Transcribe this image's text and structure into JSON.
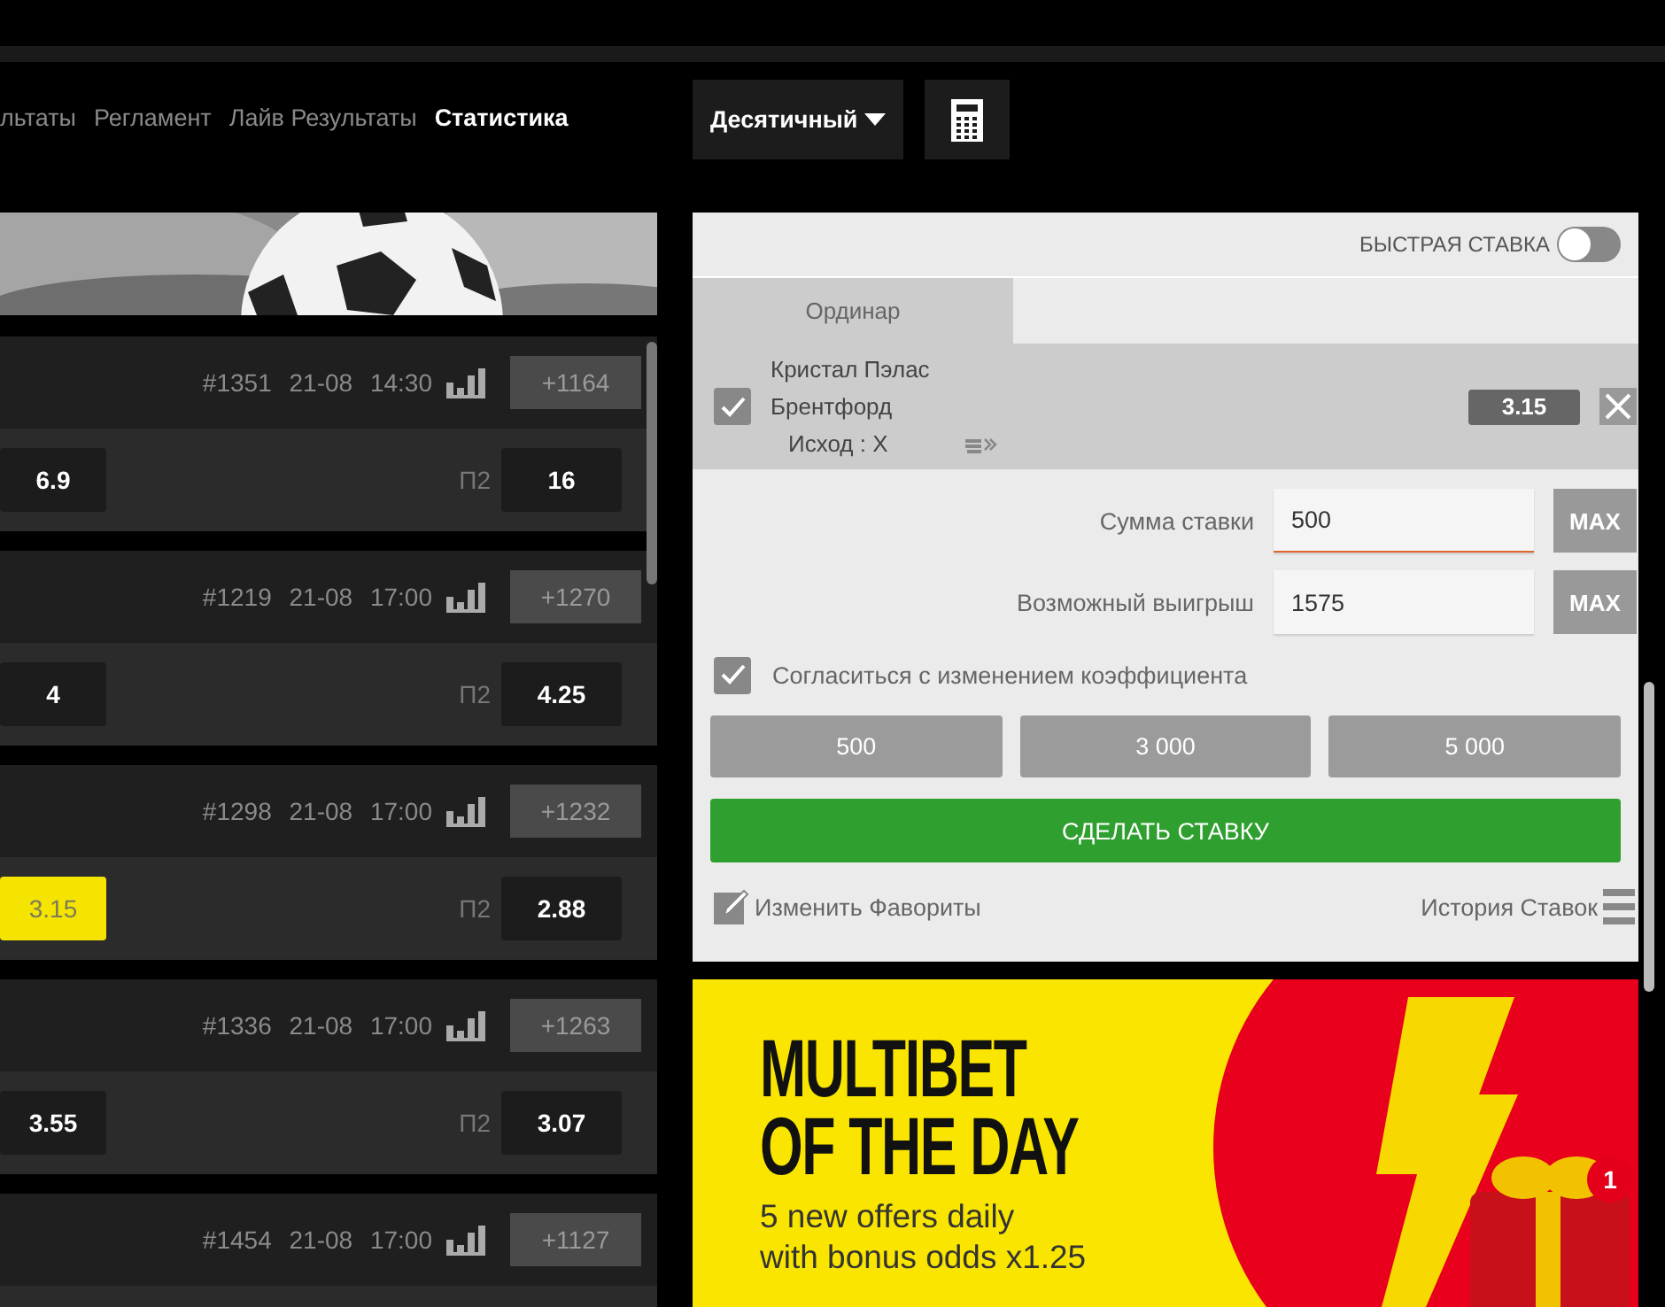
{
  "nav": {
    "links": [
      {
        "label": "льтаты",
        "selected": false
      },
      {
        "label": "Регламент",
        "selected": false
      },
      {
        "label": "Лайв Результаты",
        "selected": false
      },
      {
        "label": "Статистика",
        "selected": true
      }
    ],
    "odds_format": "Десятичный"
  },
  "matches": [
    {
      "number": "#1351",
      "date": "21-08",
      "time": "14:30",
      "more": "+1164",
      "odds": {
        "left": {
          "value": "6.9",
          "selected": false
        },
        "p2_label": "П2",
        "right": {
          "value": "16",
          "selected": false
        }
      }
    },
    {
      "number": "#1219",
      "date": "21-08",
      "time": "17:00",
      "more": "+1270",
      "odds": {
        "left": {
          "value": "4",
          "selected": false
        },
        "p2_label": "П2",
        "right": {
          "value": "4.25",
          "selected": false
        }
      }
    },
    {
      "number": "#1298",
      "date": "21-08",
      "time": "17:00",
      "more": "+1232",
      "odds": {
        "left": {
          "value": "3.15",
          "selected": true
        },
        "p2_label": "П2",
        "right": {
          "value": "2.88",
          "selected": false
        }
      }
    },
    {
      "number": "#1336",
      "date": "21-08",
      "time": "17:00",
      "more": "+1263",
      "odds": {
        "left": {
          "value": "3.55",
          "selected": false
        },
        "p2_label": "П2",
        "right": {
          "value": "3.07",
          "selected": false
        }
      }
    },
    {
      "number": "#1454",
      "date": "21-08",
      "time": "17:00",
      "more": "+1127"
    }
  ],
  "bet_slip": {
    "quick_bet": {
      "label": "БЫСТРАЯ СТАВКА",
      "on": false
    },
    "tabs": [
      {
        "label": "Ординар",
        "selected": true
      }
    ],
    "selection": {
      "checked": true,
      "teams": [
        "Кристал Пэлас",
        "Брентфорд"
      ],
      "outcome": "Исход : X",
      "odd": "3.15"
    },
    "stake": {
      "label": "Сумма ставки",
      "value": "500",
      "max": "MAX"
    },
    "payout": {
      "label": "Возможный выигрыш",
      "value": "1575",
      "max": "MAX"
    },
    "accept_changes": {
      "label": "Согласиться с изменением коэффициента",
      "checked": true
    },
    "quick_amounts": [
      "500",
      "3 000",
      "5 000"
    ],
    "place_bet": "СДЕЛАТЬ СТАВКУ",
    "edit_favorites": "Изменить Фавориты",
    "bet_history": "История Ставок"
  },
  "promo": {
    "title_lines": [
      "MULTIBET",
      "OF THE DAY"
    ],
    "subtitle_lines": [
      "5 new offers daily",
      "with bonus odds x1.25"
    ],
    "badge": "1"
  }
}
